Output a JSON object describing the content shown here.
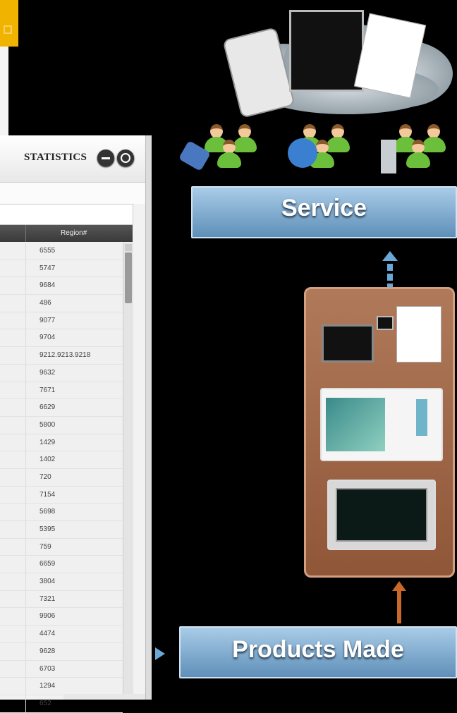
{
  "window": {
    "title": "STATISTICS",
    "column_header": "Region#",
    "rows": [
      "6555",
      "5747",
      "9684",
      "486",
      "9077",
      "9704",
      "9212.9213.9218",
      "9632",
      "7671",
      "6629",
      "5800",
      "1429",
      "1402",
      "720",
      "7154",
      "5698",
      "5395",
      "759",
      "6659",
      "3804",
      "7321",
      "9906",
      "4474",
      "9628",
      "6703",
      "1294",
      "652"
    ]
  },
  "diagram": {
    "service_label": "Service",
    "products_label": "Products Made"
  },
  "colors": {
    "box_blue": "#7fb0d8",
    "arrow_blue": "#6aa8d8",
    "arrow_orange": "#c8682a",
    "products_container": "#a06a4a",
    "people_green": "#6cbf3a"
  }
}
